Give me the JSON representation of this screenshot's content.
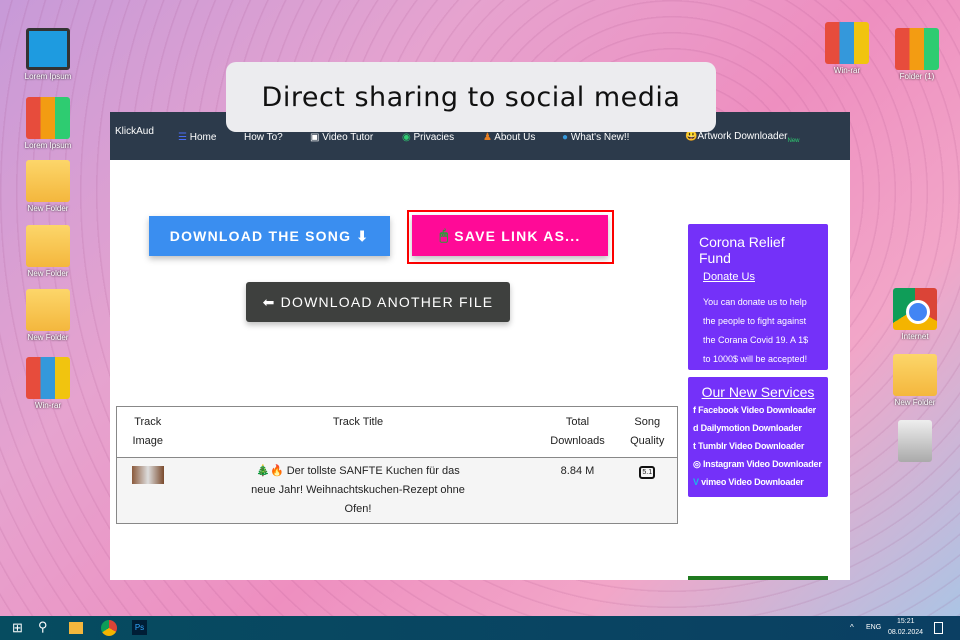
{
  "caption": "Direct sharing to social media",
  "desktop": {
    "left": [
      {
        "label": "Lorem Ipsum",
        "icon": "computer-icon"
      },
      {
        "label": "Lorem Ipsum",
        "icon": "binders-icon"
      },
      {
        "label": "New Folder",
        "icon": "folder-icon"
      },
      {
        "label": "New Folder",
        "icon": "folder-icon"
      },
      {
        "label": "New Folder",
        "icon": "folder-icon"
      },
      {
        "label": "Win-rar",
        "icon": "winrar-icon"
      }
    ],
    "right": [
      {
        "label": "Win-rar"
      },
      {
        "label": "Folder (1)"
      },
      {
        "label": "Internet"
      },
      {
        "label": "New Folder"
      },
      {
        "label": ""
      }
    ]
  },
  "nav": {
    "brand": "KlickAud",
    "items": [
      "Home",
      "How To?",
      "Video Tutor",
      "Privacies",
      "About Us",
      "What's New!!",
      "Artwork Downloader"
    ],
    "new_badge": "New"
  },
  "buttons": {
    "download_song": "DOWNLOAD THE SONG",
    "save_link": "SAVE LINK AS...",
    "download_another": "DOWNLOAD ANOTHER FILE"
  },
  "table": {
    "headers": [
      "Track Image",
      "Track Title",
      "Total Downloads",
      "Song Quality"
    ],
    "rows": [
      {
        "title": "🎄🔥 Der tollste SANFTE Kuchen für das neue Jahr! Weihnachtskuchen-Rezept ohne Ofen!",
        "downloads": "8.84 M",
        "quality": "5.1"
      }
    ]
  },
  "donate": {
    "title": "Corona Relief Fund",
    "link": "Donate Us",
    "text": "You can donate us to help the people to fight against the Corana Covid 19. A 1$ to 1000$ will be accepted!"
  },
  "services": {
    "title": "Our New Services",
    "items": [
      "Facebook Video Downloader",
      "Dailymotion Downloader",
      "Tumblr Video Downloader",
      "Instagram Video Downloader",
      "vimeo Video Downloader"
    ]
  },
  "taskbar": {
    "lang": "ENG",
    "time": "15:21",
    "date": "08.02.2024"
  },
  "colors": {
    "blue": "#3a8ef0",
    "pink": "#ff0a97",
    "dark": "#3e403e",
    "purple": "#7431f9",
    "highlight": "#ff0000"
  }
}
